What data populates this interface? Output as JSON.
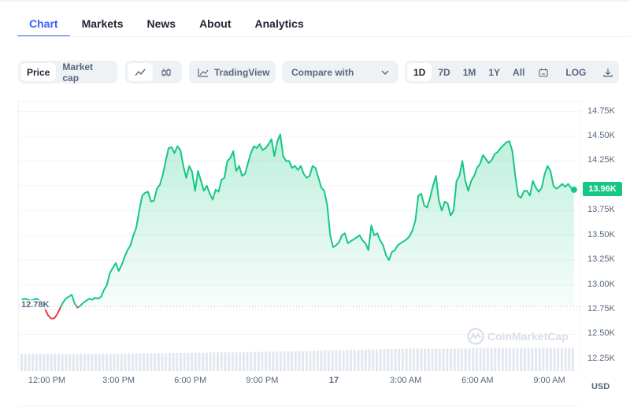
{
  "tabs": [
    {
      "label": "Chart",
      "active": true
    },
    {
      "label": "Markets",
      "active": false
    },
    {
      "label": "News",
      "active": false
    },
    {
      "label": "About",
      "active": false
    },
    {
      "label": "Analytics",
      "active": false
    }
  ],
  "toolbar": {
    "metric": {
      "options": [
        "Price",
        "Market cap"
      ],
      "selected": "Price"
    },
    "chart_style": {
      "options": [
        "line-chart-icon",
        "candlestick-icon"
      ],
      "selected": "line-chart-icon"
    },
    "tradingview_label": "TradingView",
    "compare_label": "Compare with",
    "ranges": [
      "1D",
      "7D",
      "1M",
      "1Y",
      "All"
    ],
    "selected_range": "1D",
    "log_label": "LOG",
    "calendar_icon": "calendar-icon",
    "download_icon": "download-icon"
  },
  "colors": {
    "up": "#16c784",
    "down": "#ea3943",
    "accent": "#3861fb",
    "volume": "#e3e8f0"
  },
  "watermark": "CoinMarketCap",
  "chart_data": {
    "type": "area",
    "title": "",
    "xlabel": "",
    "ylabel": "USD",
    "currency": "USD",
    "ylim": [
      12.13,
      14.85
    ],
    "y_unit": "K",
    "y_ticks": [
      "14.75K",
      "14.50K",
      "14.25K",
      "14.00K",
      "13.75K",
      "13.50K",
      "13.25K",
      "13.00K",
      "12.75K",
      "12.50K",
      "12.25K"
    ],
    "y_tick_values": [
      14.75,
      14.5,
      14.25,
      14.0,
      13.75,
      13.5,
      13.25,
      13.0,
      12.75,
      12.5,
      12.25
    ],
    "x_range_hours": [
      10.8,
      34.3
    ],
    "x_ticks": [
      {
        "label": "12:00 PM",
        "hour": 12,
        "bold": false
      },
      {
        "label": "3:00 PM",
        "hour": 15,
        "bold": false
      },
      {
        "label": "6:00 PM",
        "hour": 18,
        "bold": false
      },
      {
        "label": "9:00 PM",
        "hour": 21,
        "bold": false
      },
      {
        "label": "17",
        "hour": 24,
        "bold": true
      },
      {
        "label": "3:00 AM",
        "hour": 27,
        "bold": false
      },
      {
        "label": "6:00 AM",
        "hour": 30,
        "bold": false
      },
      {
        "label": "9:00 AM",
        "hour": 33,
        "bold": false
      }
    ],
    "baseline": {
      "value": 12.78,
      "label": "12.78K"
    },
    "current": {
      "value": 13.96,
      "label": "13.96K"
    },
    "grid": true,
    "series_start_hour": 10.92,
    "series_end_hour": 34.0,
    "series": [
      {
        "name": "Price",
        "values": [
          12.85,
          12.86,
          12.85,
          12.84,
          12.85,
          12.86,
          12.84,
          12.82,
          12.75,
          12.69,
          12.66,
          12.66,
          12.7,
          12.76,
          12.82,
          12.86,
          12.88,
          12.9,
          12.81,
          12.77,
          12.79,
          12.82,
          12.84,
          12.86,
          12.85,
          12.87,
          12.86,
          12.88,
          12.95,
          13.0,
          13.12,
          13.17,
          13.22,
          13.14,
          13.2,
          13.28,
          13.35,
          13.4,
          13.5,
          13.58,
          13.75,
          13.9,
          13.93,
          13.94,
          13.84,
          13.85,
          13.97,
          14.01,
          14.11,
          14.25,
          14.38,
          14.39,
          14.33,
          14.4,
          14.36,
          14.2,
          14.08,
          14.2,
          14.14,
          13.95,
          14.15,
          14.05,
          13.95,
          14.0,
          13.92,
          13.86,
          13.96,
          13.94,
          14.06,
          14.08,
          14.25,
          14.28,
          14.35,
          14.15,
          14.2,
          14.1,
          14.12,
          14.23,
          14.33,
          14.4,
          14.38,
          14.42,
          14.36,
          14.38,
          14.42,
          14.47,
          14.3,
          14.45,
          14.52,
          14.3,
          14.25,
          14.25,
          14.18,
          14.2,
          14.16,
          14.2,
          14.12,
          14.08,
          14.1,
          14.2,
          14.18,
          14.08,
          13.98,
          13.95,
          13.8,
          13.5,
          13.38,
          13.4,
          13.43,
          13.5,
          13.52,
          13.42,
          13.44,
          13.46,
          13.48,
          13.5,
          13.45,
          13.42,
          13.35,
          13.6,
          13.5,
          13.52,
          13.45,
          13.4,
          13.3,
          13.25,
          13.33,
          13.35,
          13.4,
          13.42,
          13.44,
          13.46,
          13.49,
          13.55,
          13.65,
          13.9,
          13.92,
          13.8,
          13.78,
          13.88,
          14.0,
          14.1,
          13.85,
          13.75,
          13.84,
          13.82,
          13.7,
          13.75,
          14.05,
          14.1,
          14.25,
          14.05,
          13.95,
          14.05,
          14.1,
          14.18,
          14.22,
          14.31,
          14.27,
          14.23,
          14.26,
          14.32,
          14.34,
          14.38,
          14.41,
          14.44,
          14.45,
          14.35,
          14.1,
          13.9,
          13.88,
          13.95,
          13.95,
          13.9,
          14.05,
          13.98,
          13.94,
          13.98,
          14.12,
          14.2,
          14.15,
          14.0,
          13.97,
          13.99,
          14.02,
          13.99,
          14.02,
          13.98,
          13.96
        ]
      },
      {
        "name": "Volume",
        "relative_values": [
          0.55,
          0.55,
          0.55,
          0.55,
          0.55,
          0.55,
          0.55,
          0.55,
          0.55,
          0.55,
          0.55,
          0.55,
          0.55,
          0.55,
          0.56,
          0.56,
          0.57,
          0.57,
          0.57,
          0.57,
          0.58,
          0.58,
          0.58,
          0.59,
          0.59,
          0.59,
          0.6,
          0.6,
          0.6,
          0.6,
          0.6,
          0.61,
          0.61,
          0.62,
          0.62,
          0.62,
          0.63,
          0.63,
          0.64,
          0.64,
          0.65,
          0.66,
          0.66,
          0.67,
          0.67,
          0.68,
          0.68,
          0.69,
          0.69,
          0.7,
          0.71,
          0.71,
          0.71,
          0.72,
          0.72,
          0.72,
          0.72,
          0.72,
          0.72,
          0.72,
          0.72,
          0.72,
          0.73,
          0.73,
          0.73,
          0.74,
          0.74,
          0.74,
          0.74,
          0.74,
          0.74,
          0.74,
          0.74,
          0.74,
          0.74,
          0.74
        ]
      }
    ]
  }
}
